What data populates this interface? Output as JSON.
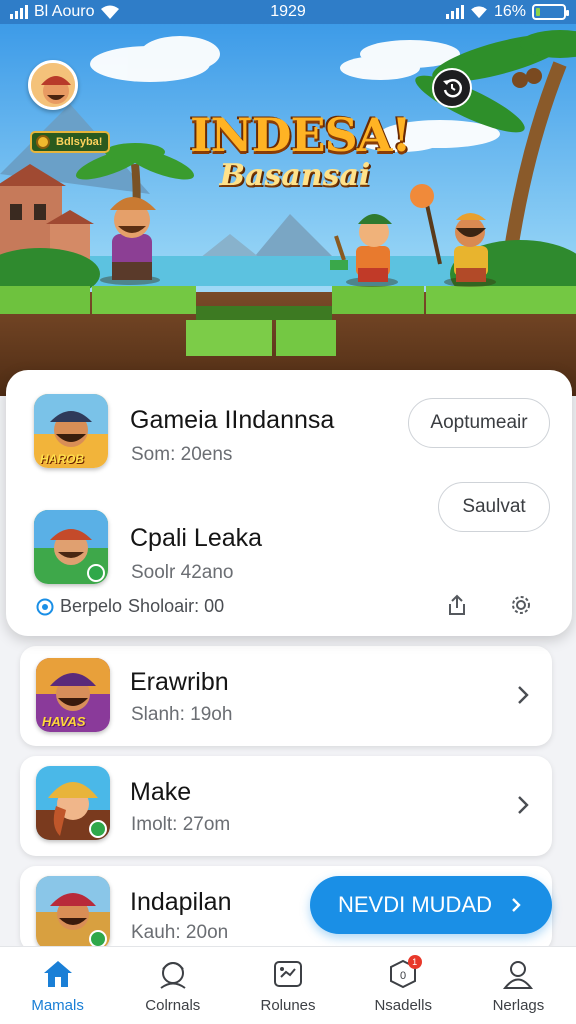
{
  "status_bar": {
    "carrier": "Bl Aouro",
    "time": "1929",
    "battery": "16%",
    "battery_level": 0.16
  },
  "hero": {
    "badge": "Bdlsyba!",
    "title_line1": "INDESA!",
    "title_line2": "Basansai",
    "avatar_icon": "avatar-icon",
    "history_icon": "history-icon"
  },
  "featured": {
    "items": [
      {
        "name": "Gameia IIndannsa",
        "meta": "Som: 20ens",
        "button": "Aoptumeair",
        "icon_label": "HAROB"
      },
      {
        "name": "Cpali Leaka",
        "meta": "Soolr 42ano",
        "button": "Saulvat"
      }
    ],
    "footer_text": "Berpelo",
    "footer_value": "Sholoair: 00",
    "share_icon": "share-icon",
    "settings_icon": "gear-icon"
  },
  "list": [
    {
      "name": "Erawribn",
      "meta": "Slanh: 19oh",
      "icon_label": "HAVAS"
    },
    {
      "name": "Make",
      "meta": "Imolt: 27om"
    },
    {
      "name": "Indapilan",
      "meta": "Kauh: 20on"
    }
  ],
  "fab": {
    "label": "NEVDI MUDAD"
  },
  "nav": [
    {
      "label": "Mamals",
      "icon": "home-icon",
      "active": true
    },
    {
      "label": "Colrnals",
      "icon": "avatar-icon"
    },
    {
      "label": "Rolunes",
      "icon": "gamepad-icon"
    },
    {
      "label": "Nsadells",
      "icon": "notification-icon",
      "badge": "1"
    },
    {
      "label": "Nerlags",
      "icon": "profile-icon"
    }
  ],
  "colors": {
    "accent": "#1a8fe6",
    "status_bar": "#2f7dc8",
    "title_gold": "#ffb324",
    "badge_red": "#e8382a"
  }
}
